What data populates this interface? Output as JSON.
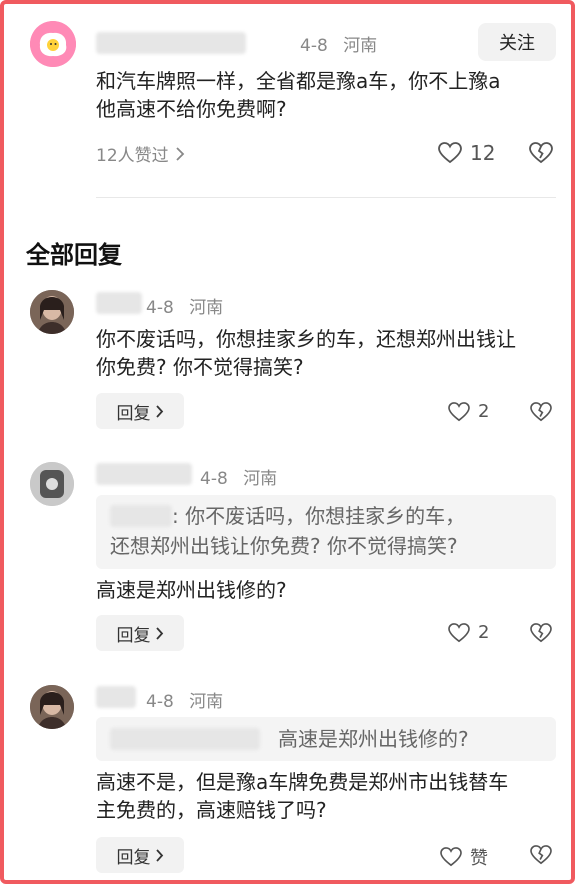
{
  "main_comment": {
    "date": "4-8",
    "region": "河南",
    "follow_label": "关注",
    "text_line1": "和汽车牌照一样，全省都是豫a车，你不上豫a",
    "text_line2": "他高速不给你免费啊?",
    "likes_summary": "12人赞过",
    "like_count": "12"
  },
  "section_title": "全部回复",
  "replies": [
    {
      "date": "4-8",
      "region": "河南",
      "text_line1": "你不废话吗，你想挂家乡的车，还想郑州出钱让",
      "text_line2": "你免费? 你不觉得搞笑?",
      "reply_label": "回复",
      "like_count": "2"
    },
    {
      "date": "4-8",
      "region": "河南",
      "quote_line1": ": 你不废话吗，你想挂家乡的车，",
      "quote_line2": "还想郑州出钱让你免费? 你不觉得搞笑?",
      "text_line1": "高速是郑州出钱修的?",
      "reply_label": "回复",
      "like_count": "2"
    },
    {
      "date": "4-8",
      "region": "河南",
      "quote_line1": "高速是郑州出钱修的?",
      "text_line1": "高速不是，但是豫a车牌免费是郑州市出钱替车",
      "text_line2": "主免费的，高速赔钱了吗?",
      "reply_label": "回复",
      "like_label": "赞"
    }
  ],
  "colors": {
    "frame": "#f05a5f",
    "meta": "#888888",
    "button_bg": "#f2f2f2"
  },
  "icons": [
    "chevron-right-icon",
    "heart-icon",
    "broken-heart-icon"
  ]
}
